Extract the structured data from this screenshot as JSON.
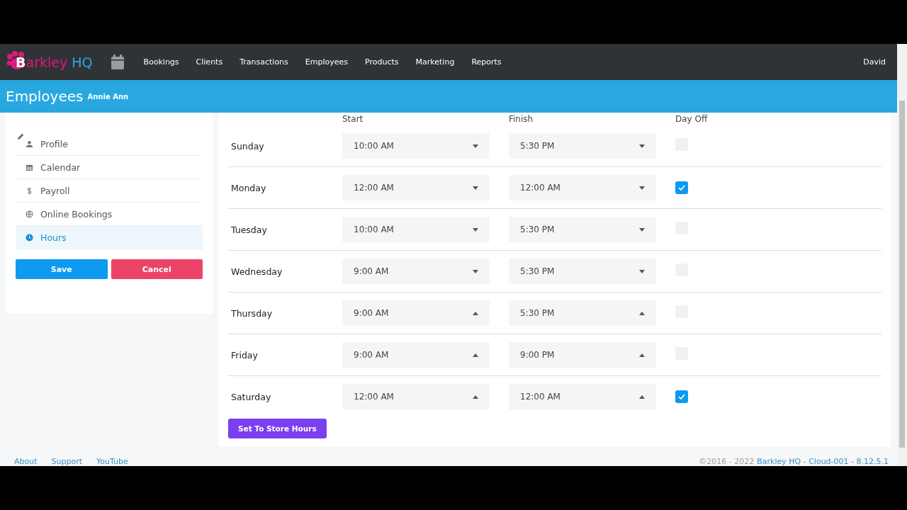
{
  "nav": {
    "logo": {
      "first": "B",
      "rest": "arkley",
      "suffix": "HQ"
    },
    "items": [
      {
        "label": "Bookings"
      },
      {
        "label": "Clients"
      },
      {
        "label": "Transactions"
      },
      {
        "label": "Employees"
      },
      {
        "label": "Products"
      },
      {
        "label": "Marketing"
      },
      {
        "label": "Reports"
      }
    ],
    "user": "David"
  },
  "header": {
    "title": "Employees",
    "subtitle": "Annie Ann"
  },
  "sidebar": {
    "items": [
      {
        "label": "Profile",
        "kind": "person",
        "selected": false
      },
      {
        "label": "Calendar",
        "kind": "calendar",
        "selected": false
      },
      {
        "label": "Payroll",
        "kind": "dollar",
        "selected": false
      },
      {
        "label": "Online Bookings",
        "kind": "globe",
        "selected": false
      },
      {
        "label": "Hours",
        "kind": "clock",
        "selected": true
      }
    ],
    "buttons": [
      {
        "label": "Save",
        "kind": "primary"
      },
      {
        "label": "Cancel",
        "kind": "danger"
      }
    ]
  },
  "hours": {
    "columns": [
      "Start",
      "Finish",
      "Day Off"
    ],
    "rows": [
      {
        "day": "Sunday",
        "start": "10:00 AM",
        "finish": "5:30 PM",
        "day_off": false,
        "opens_upward": false
      },
      {
        "day": "Monday",
        "start": "12:00 AM",
        "finish": "12:00 AM",
        "day_off": true,
        "opens_upward": false
      },
      {
        "day": "Tuesday",
        "start": "10:00 AM",
        "finish": "5:30 PM",
        "day_off": false,
        "opens_upward": false
      },
      {
        "day": "Wednesday",
        "start": "9:00 AM",
        "finish": "5:30 PM",
        "day_off": false,
        "opens_upward": false
      },
      {
        "day": "Thursday",
        "start": "9:00 AM",
        "finish": "5:30 PM",
        "day_off": false,
        "opens_upward": true
      },
      {
        "day": "Friday",
        "start": "9:00 AM",
        "finish": "9:00 PM",
        "day_off": false,
        "opens_upward": true
      },
      {
        "day": "Saturday",
        "start": "12:00 AM",
        "finish": "12:00 AM",
        "day_off": true,
        "opens_upward": true
      }
    ],
    "store_hours_button": "Set To Store Hours"
  },
  "footer": {
    "links": [
      "About",
      "Support",
      "YouTube"
    ],
    "copyright": "©2016 - 2022",
    "version_link": "Barkley HQ - Cloud-001 - 8.12.5.1"
  }
}
